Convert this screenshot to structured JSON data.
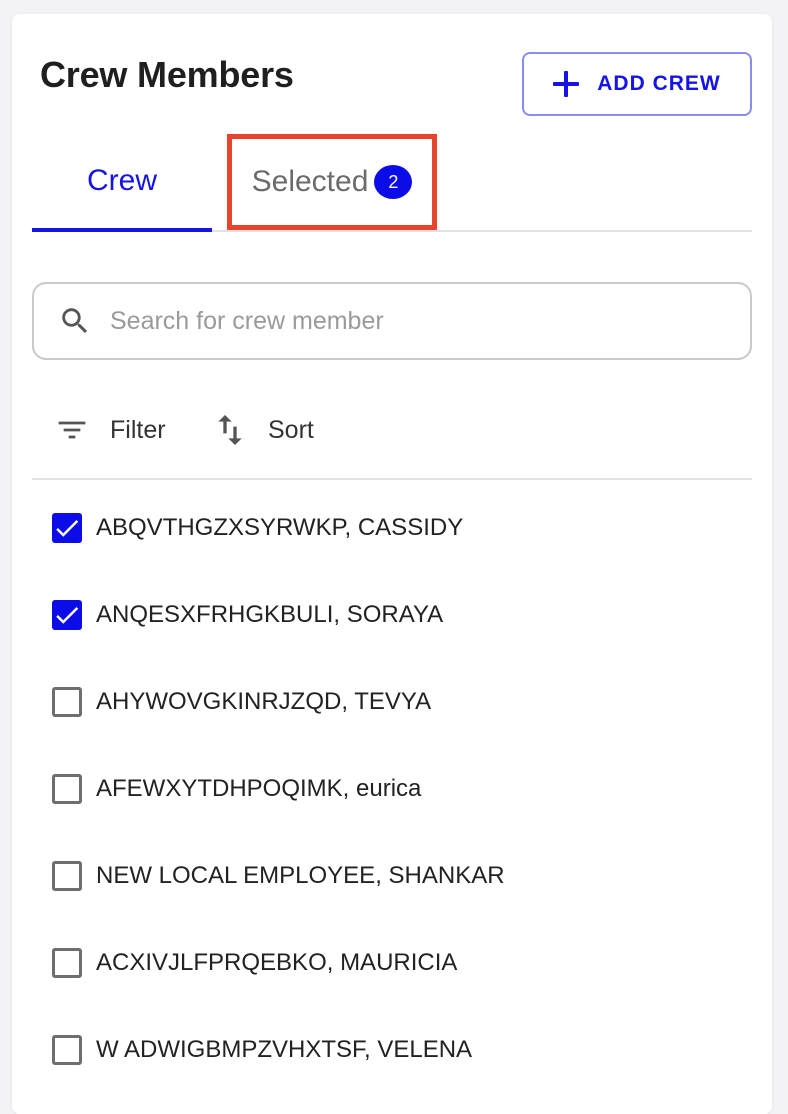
{
  "header": {
    "title": "Crew Members",
    "add_label": "ADD CREW"
  },
  "tabs": [
    {
      "label": "Crew",
      "active": true
    },
    {
      "label": "Selected",
      "badge": "2",
      "active": false,
      "highlight_color": "#e8432b"
    }
  ],
  "search": {
    "placeholder": "Search for crew member",
    "value": ""
  },
  "toolbar": {
    "filter_label": "Filter",
    "sort_label": "Sort"
  },
  "crew_list": [
    {
      "name": "ABQVTHGZXSYRWKP, CASSIDY",
      "checked": true
    },
    {
      "name": "ANQESXFRHGKBULI, SORAYA",
      "checked": true
    },
    {
      "name": "AHYWOVGKINRJZQD, TEVYA",
      "checked": false
    },
    {
      "name": "AFEWXYTDHPOQIMK, eurica",
      "checked": false
    },
    {
      "name": "NEW LOCAL EMPLOYEE, SHANKAR",
      "checked": false
    },
    {
      "name": "ACXIVJLFPRQEBKO, MAURICIA",
      "checked": false
    },
    {
      "name": "W ADWIGBMPZVHXTSF, VELENA",
      "checked": false
    }
  ],
  "colors": {
    "accent": "#1414e6",
    "badge": "#0c0ce8",
    "highlight": "#e8432b"
  },
  "icons": {
    "add": "plus-icon",
    "search": "search-icon",
    "filter": "filter-icon",
    "sort": "sort-icon"
  }
}
